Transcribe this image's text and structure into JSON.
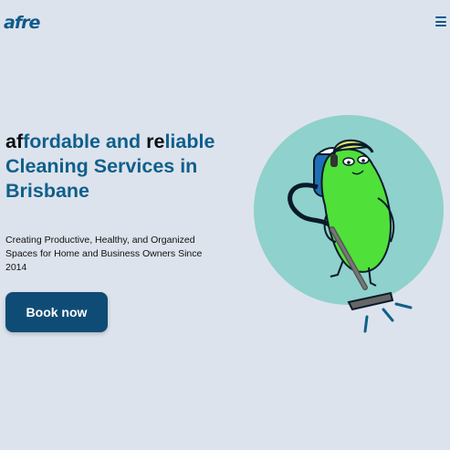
{
  "header": {
    "logo_text": "afre",
    "menu_icon": "hamburger-menu-icon"
  },
  "hero": {
    "headline_parts": [
      {
        "text": "af",
        "style": "dark"
      },
      {
        "text": "fordable and ",
        "style": "accent"
      },
      {
        "text": "re",
        "style": "dark"
      },
      {
        "text": "liable Cleaning Services in Brisbane",
        "style": "accent"
      }
    ],
    "subtext": "Creating Productive, Healthy, and Organized Spaces for Home and Business Owners Since 2014",
    "cta_label": "Book now",
    "illustration": "cleaning-pickle-with-vacuum-illustration"
  },
  "colors": {
    "background": "#dde3ec",
    "accent": "#0f5f8c",
    "dark_text": "#0b0f14",
    "button": "#0f4c75",
    "circle": "#8fd1cc",
    "character": "#4fe03a"
  }
}
